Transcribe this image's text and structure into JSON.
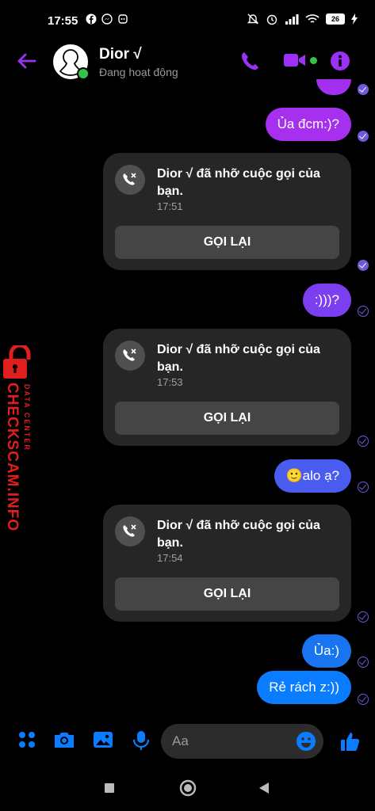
{
  "status_bar": {
    "time": "17:55",
    "battery": "26"
  },
  "header": {
    "contact_name": "Dior √",
    "status_text": "Đang hoạt động"
  },
  "messages": [
    {
      "text": "Ủa đcm:)?"
    },
    {
      "text": ":)))?"
    },
    {
      "text": "🙂alo ạ?"
    },
    {
      "text": "Ủa:)"
    },
    {
      "text": "Rẻ rách z:))"
    }
  ],
  "missed_calls": [
    {
      "text": "Dior √ đã nhỡ cuộc gọi của bạn.",
      "time": "17:51",
      "button": "GỌI LẠI"
    },
    {
      "text": "Dior √ đã nhỡ cuộc gọi của bạn.",
      "time": "17:53",
      "button": "GỌI LẠI"
    },
    {
      "text": "Dior √ đã nhỡ cuộc gọi của bạn.",
      "time": "17:54",
      "button": "GỌI LẠI"
    }
  ],
  "watermark": {
    "brand": "CHECKSCAM.INFO",
    "sub": "DATA CENTER"
  },
  "composer": {
    "placeholder": "Aa"
  },
  "colors": {
    "accent": "#9b30f6",
    "blue": "#0a7cff",
    "online": "#31c449"
  }
}
